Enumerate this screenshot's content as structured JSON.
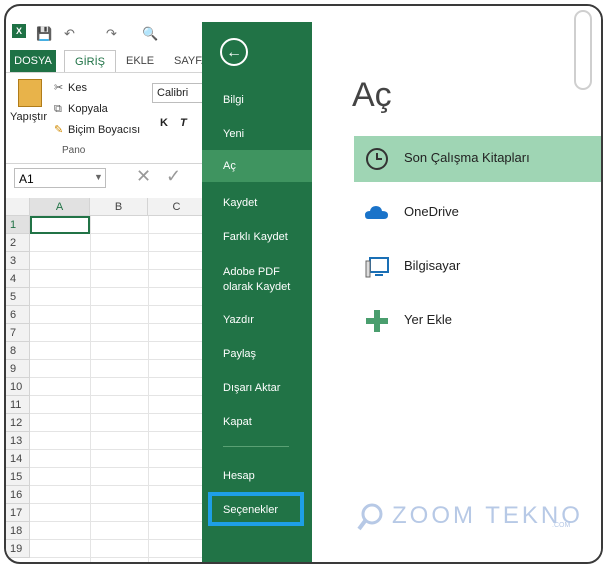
{
  "excel": {
    "logo": "X",
    "tabs": [
      "DOSYA",
      "GİRİŞ",
      "EKLE",
      "SAYFA"
    ],
    "clipboard": {
      "paste": "Yapıştır",
      "cut": "Kes",
      "copy": "Kopyala",
      "format_painter": "Biçim Boyacısı",
      "group": "Pano"
    },
    "font": {
      "name": "Calibri",
      "bold": "K",
      "italic": "T"
    },
    "name_box": "A1",
    "columns": [
      "A",
      "B",
      "C"
    ],
    "rows": [
      "1",
      "2",
      "3",
      "4",
      "5",
      "6",
      "7",
      "8",
      "9",
      "10",
      "11",
      "12",
      "13",
      "14",
      "15",
      "16",
      "17",
      "18",
      "19"
    ]
  },
  "backstage": {
    "back_icon": "arrow-left-icon",
    "nav_items": [
      "Bilgi",
      "Yeni",
      "Aç",
      "Kaydet",
      "Farklı Kaydet",
      "Adobe PDF\nolarak Kaydet",
      "Yazdır",
      "Paylaş",
      "Dışarı Aktar",
      "Kapat"
    ],
    "account": "Hesap",
    "options": "Seçenekler",
    "accent": "#217346"
  },
  "open": {
    "title": "Aç",
    "locations": [
      {
        "label": "Son Çalışma Kitapları",
        "icon": "clock-icon"
      },
      {
        "label": "OneDrive",
        "icon": "cloud-icon"
      },
      {
        "label": "Bilgisayar",
        "icon": "computer-icon"
      },
      {
        "label": "Yer Ekle",
        "icon": "plus-icon"
      }
    ]
  },
  "watermark": {
    "text": "ZOOM TEKNO",
    "sub": ".COM"
  }
}
